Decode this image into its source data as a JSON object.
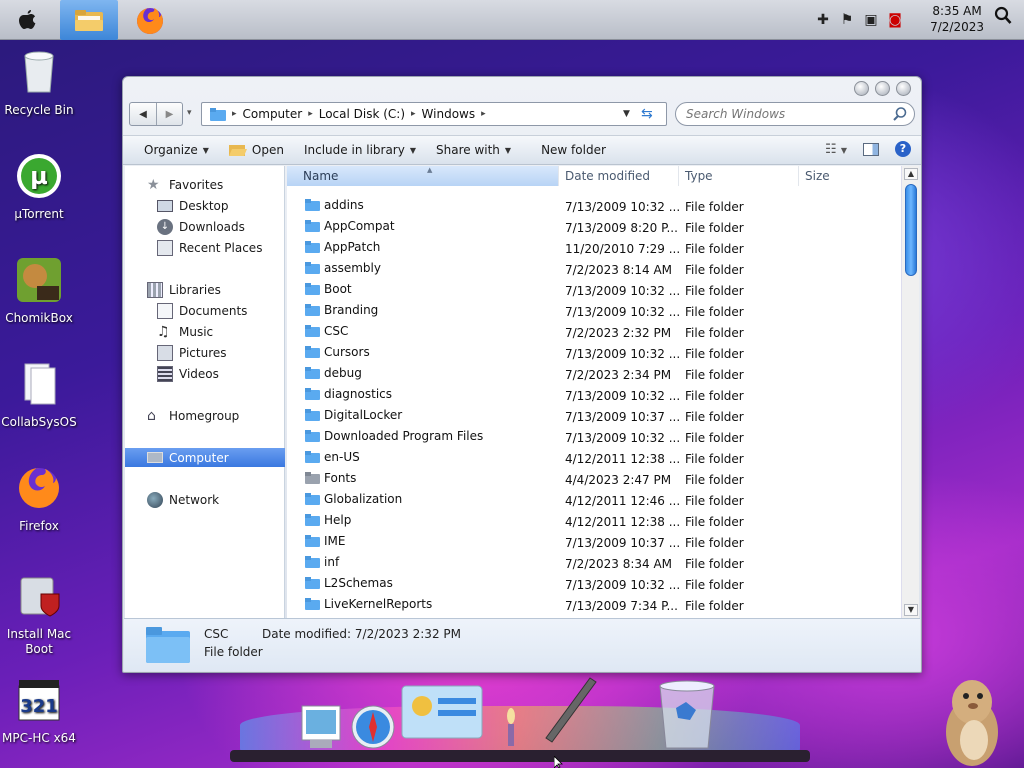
{
  "topbar": {
    "clock_time": "8:35 AM",
    "clock_date": "7/2/2023",
    "tray_icons": [
      "plus-icon",
      "flag-icon",
      "network-icon",
      "volume-muted-icon"
    ]
  },
  "desktop_icons": [
    {
      "label": "Recycle Bin",
      "icon": "recycle-bin-icon"
    },
    {
      "label": "µTorrent",
      "icon": "utorrent-icon"
    },
    {
      "label": "ChomikBox",
      "icon": "chomikbox-icon"
    },
    {
      "label": "CollabSysOS",
      "icon": "document-icon"
    },
    {
      "label": "Firefox",
      "icon": "firefox-icon"
    },
    {
      "label": "Install Mac Boot",
      "icon": "installer-icon"
    },
    {
      "label": "MPC-HC x64",
      "icon": "mpc-hc-icon"
    }
  ],
  "window": {
    "breadcrumb": [
      "Computer",
      "Local Disk (C:)",
      "Windows"
    ],
    "search_placeholder": "Search Windows",
    "toolbar": {
      "organize": "Organize",
      "open": "Open",
      "include": "Include in library",
      "share": "Share with",
      "new_folder": "New folder"
    },
    "nav": {
      "favorites": "Favorites",
      "desktop": "Desktop",
      "downloads": "Downloads",
      "recent": "Recent Places",
      "libraries": "Libraries",
      "documents": "Documents",
      "music": "Music",
      "pictures": "Pictures",
      "videos": "Videos",
      "homegroup": "Homegroup",
      "computer": "Computer",
      "network": "Network"
    },
    "columns": {
      "name": "Name",
      "date": "Date modified",
      "type": "Type",
      "size": "Size"
    },
    "files": [
      {
        "name": "addins",
        "date": "7/13/2009 10:32 ...",
        "type": "File folder"
      },
      {
        "name": "AppCompat",
        "date": "7/13/2009 8:20 P...",
        "type": "File folder"
      },
      {
        "name": "AppPatch",
        "date": "11/20/2010 7:29 ...",
        "type": "File folder"
      },
      {
        "name": "assembly",
        "date": "7/2/2023 8:14 AM",
        "type": "File folder"
      },
      {
        "name": "Boot",
        "date": "7/13/2009 10:32 ...",
        "type": "File folder"
      },
      {
        "name": "Branding",
        "date": "7/13/2009 10:32 ...",
        "type": "File folder"
      },
      {
        "name": "CSC",
        "date": "7/2/2023 2:32 PM",
        "type": "File folder"
      },
      {
        "name": "Cursors",
        "date": "7/13/2009 10:32 ...",
        "type": "File folder"
      },
      {
        "name": "debug",
        "date": "7/2/2023 2:34 PM",
        "type": "File folder"
      },
      {
        "name": "diagnostics",
        "date": "7/13/2009 10:32 ...",
        "type": "File folder"
      },
      {
        "name": "DigitalLocker",
        "date": "7/13/2009 10:37 ...",
        "type": "File folder"
      },
      {
        "name": "Downloaded Program Files",
        "date": "7/13/2009 10:32 ...",
        "type": "File folder"
      },
      {
        "name": "en-US",
        "date": "4/12/2011 12:38 ...",
        "type": "File folder"
      },
      {
        "name": "Fonts",
        "date": "4/4/2023 2:47 PM",
        "type": "File folder"
      },
      {
        "name": "Globalization",
        "date": "4/12/2011 12:46 ...",
        "type": "File folder"
      },
      {
        "name": "Help",
        "date": "4/12/2011 12:38 ...",
        "type": "File folder"
      },
      {
        "name": "IME",
        "date": "7/13/2009 10:37 ...",
        "type": "File folder"
      },
      {
        "name": "inf",
        "date": "7/2/2023 8:34 AM",
        "type": "File folder"
      },
      {
        "name": "L2Schemas",
        "date": "7/13/2009 10:32 ...",
        "type": "File folder"
      },
      {
        "name": "LiveKernelReports",
        "date": "7/13/2009 7:34 P...",
        "type": "File folder"
      }
    ],
    "details": {
      "name": "CSC",
      "type": "File folder",
      "date_label": "Date modified:",
      "date_value": "7/2/2023 2:32 PM"
    }
  },
  "colors": {
    "accent": "#3a78e0",
    "selection": "#b8d4f5",
    "folder": "#5aaaf0"
  }
}
